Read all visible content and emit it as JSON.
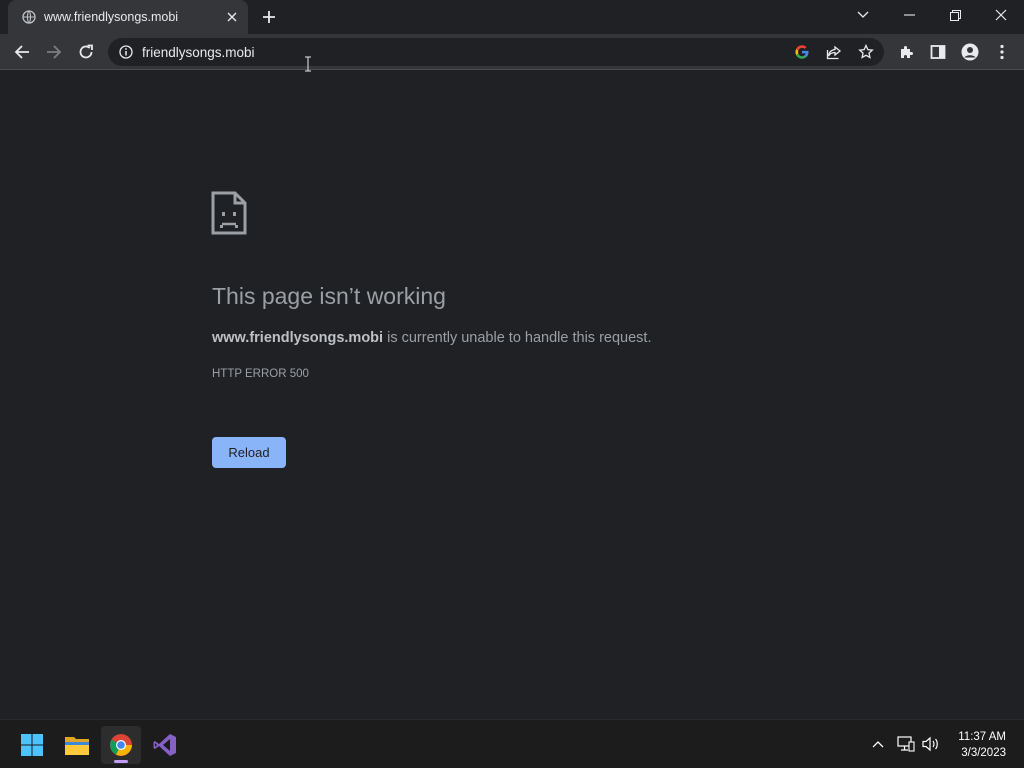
{
  "browser": {
    "tab": {
      "title": "www.friendlysongs.mobi"
    },
    "address_bar": {
      "url": "friendlysongs.mobi"
    }
  },
  "error_page": {
    "headline": "This page isn’t working",
    "domain": "www.friendlysongs.mobi",
    "message": " is currently unable to handle this request.",
    "error_code": "HTTP ERROR 500",
    "reload_label": "Reload"
  },
  "taskbar": {
    "apps": [
      "start-icon",
      "file-explorer-icon",
      "chrome-icon",
      "visual-studio-icon"
    ],
    "clock": {
      "time": "11:37 AM",
      "date": "3/3/2023"
    }
  },
  "colors": {
    "background": "#202124",
    "toolbar": "#35363a",
    "accent": "#8ab4f8",
    "text_muted": "#9aa0a6"
  }
}
